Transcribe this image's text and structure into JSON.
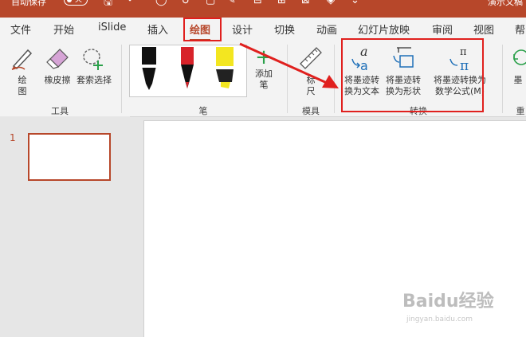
{
  "titlebar": {
    "autosave_label": "自动保存",
    "autosave_state": "关",
    "doc_title": "演示文稿"
  },
  "tabs": [
    {
      "label": "文件"
    },
    {
      "label": "开始"
    },
    {
      "label": "iSlide"
    },
    {
      "label": "插入"
    },
    {
      "label": "绘图"
    },
    {
      "label": "设计"
    },
    {
      "label": "切换"
    },
    {
      "label": "动画"
    },
    {
      "label": "幻灯片放映"
    },
    {
      "label": "审阅"
    },
    {
      "label": "视图"
    },
    {
      "label": "帮"
    }
  ],
  "ribbon": {
    "tools": {
      "group_label": "工具",
      "draw_line1": "绘",
      "draw_line2": "图",
      "eraser_label": "橡皮擦",
      "lasso_label": "套索选择"
    },
    "pens": {
      "group_label": "笔",
      "pen_colors": [
        "#111111",
        "#d8232a",
        "#f3e620"
      ],
      "add_pen_line1": "添加",
      "add_pen_line2": "笔"
    },
    "stencils": {
      "group_label": "模具",
      "ruler_line1": "标",
      "ruler_line2": "尺"
    },
    "convert": {
      "group_label": "转换",
      "ink_to_text_line1": "将墨迹转",
      "ink_to_text_line2": "换为文本",
      "ink_to_shape_line1": "将墨迹转",
      "ink_to_shape_line2": "换为形状",
      "ink_to_math_line1": "将墨迹转换为",
      "ink_to_math_line2": "数学公式(M)"
    },
    "replay": {
      "label1": "墨",
      "label2": "重"
    }
  },
  "slides": {
    "thumb_number": "1"
  },
  "watermark": {
    "main": "Baidu经验",
    "sub": "jingyan.baidu.com"
  },
  "colors": {
    "accent": "#b7472a",
    "annotation": "#e0201e"
  }
}
